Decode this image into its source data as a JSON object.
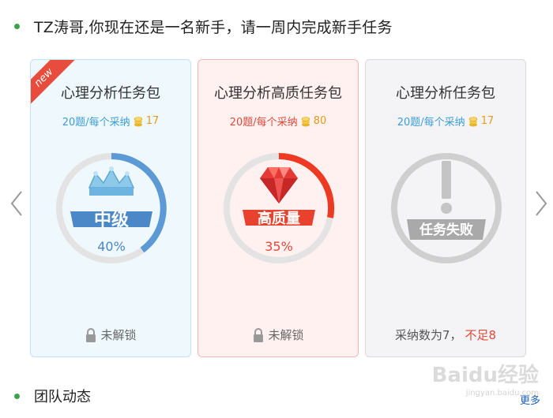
{
  "header": {
    "text": "TZ涛哥,你现在还是一名新手，请一周内完成新手任务"
  },
  "cards": [
    {
      "badge": "new",
      "title": "心理分析任务包",
      "sub_text": "20题/每个采纳",
      "reward": "17",
      "level": "中级",
      "percent": "40%",
      "status": "未解锁"
    },
    {
      "title": "心理分析高质任务包",
      "sub_text": "20题/每个采纳",
      "reward": "80",
      "level": "高质量",
      "percent": "35%",
      "status": "未解锁"
    },
    {
      "title": "心理分析任务包",
      "sub_text": "20题/每个采纳",
      "reward": "17",
      "level": "任务失败",
      "status_prefix": "采纳数为7，",
      "status_suffix": "不足8"
    }
  ],
  "section": {
    "label": "团队动态",
    "more": "更多"
  },
  "watermark": {
    "text": "Baidu经验",
    "url": "jingyan.baidu.com"
  },
  "colors": {
    "blue": "#5c9ad6",
    "red": "#ee3a23",
    "gray": "#cfcfcf",
    "green_dot": "#3aa34a"
  }
}
